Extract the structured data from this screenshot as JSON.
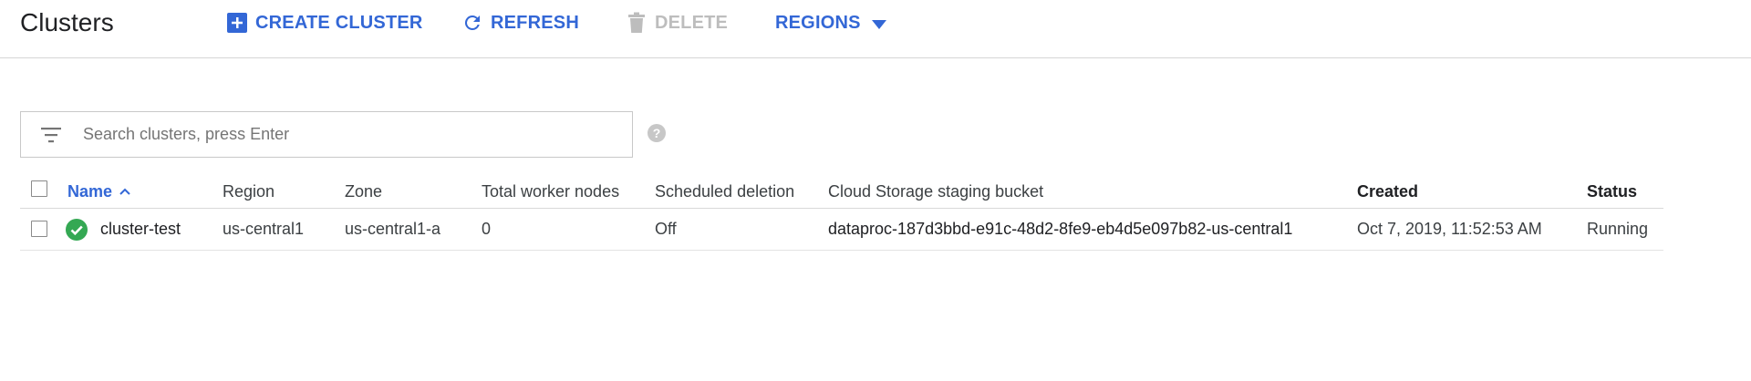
{
  "header": {
    "title": "Clusters",
    "create_label": "CREATE CLUSTER",
    "refresh_label": "REFRESH",
    "delete_label": "DELETE",
    "regions_label": "REGIONS"
  },
  "search": {
    "placeholder": "Search clusters, press Enter",
    "value": ""
  },
  "table": {
    "columns": {
      "name": "Name",
      "region": "Region",
      "zone": "Zone",
      "total_worker_nodes": "Total worker nodes",
      "scheduled_deletion": "Scheduled deletion",
      "staging_bucket": "Cloud Storage staging bucket",
      "created": "Created",
      "status": "Status"
    },
    "rows": [
      {
        "name": "cluster-test",
        "region": "us-central1",
        "zone": "us-central1-a",
        "total_worker_nodes": "0",
        "scheduled_deletion": "Off",
        "staging_bucket": "dataproc-187d3bbd-e91c-48d2-8fe9-eb4d5e097b82-us-central1",
        "created": "Oct 7, 2019, 11:52:53 AM",
        "status": "Running",
        "status_icon": "check-circle-icon"
      }
    ]
  },
  "colors": {
    "accent": "#3367d6",
    "success": "#34a853",
    "disabled": "#bdbdbd"
  }
}
